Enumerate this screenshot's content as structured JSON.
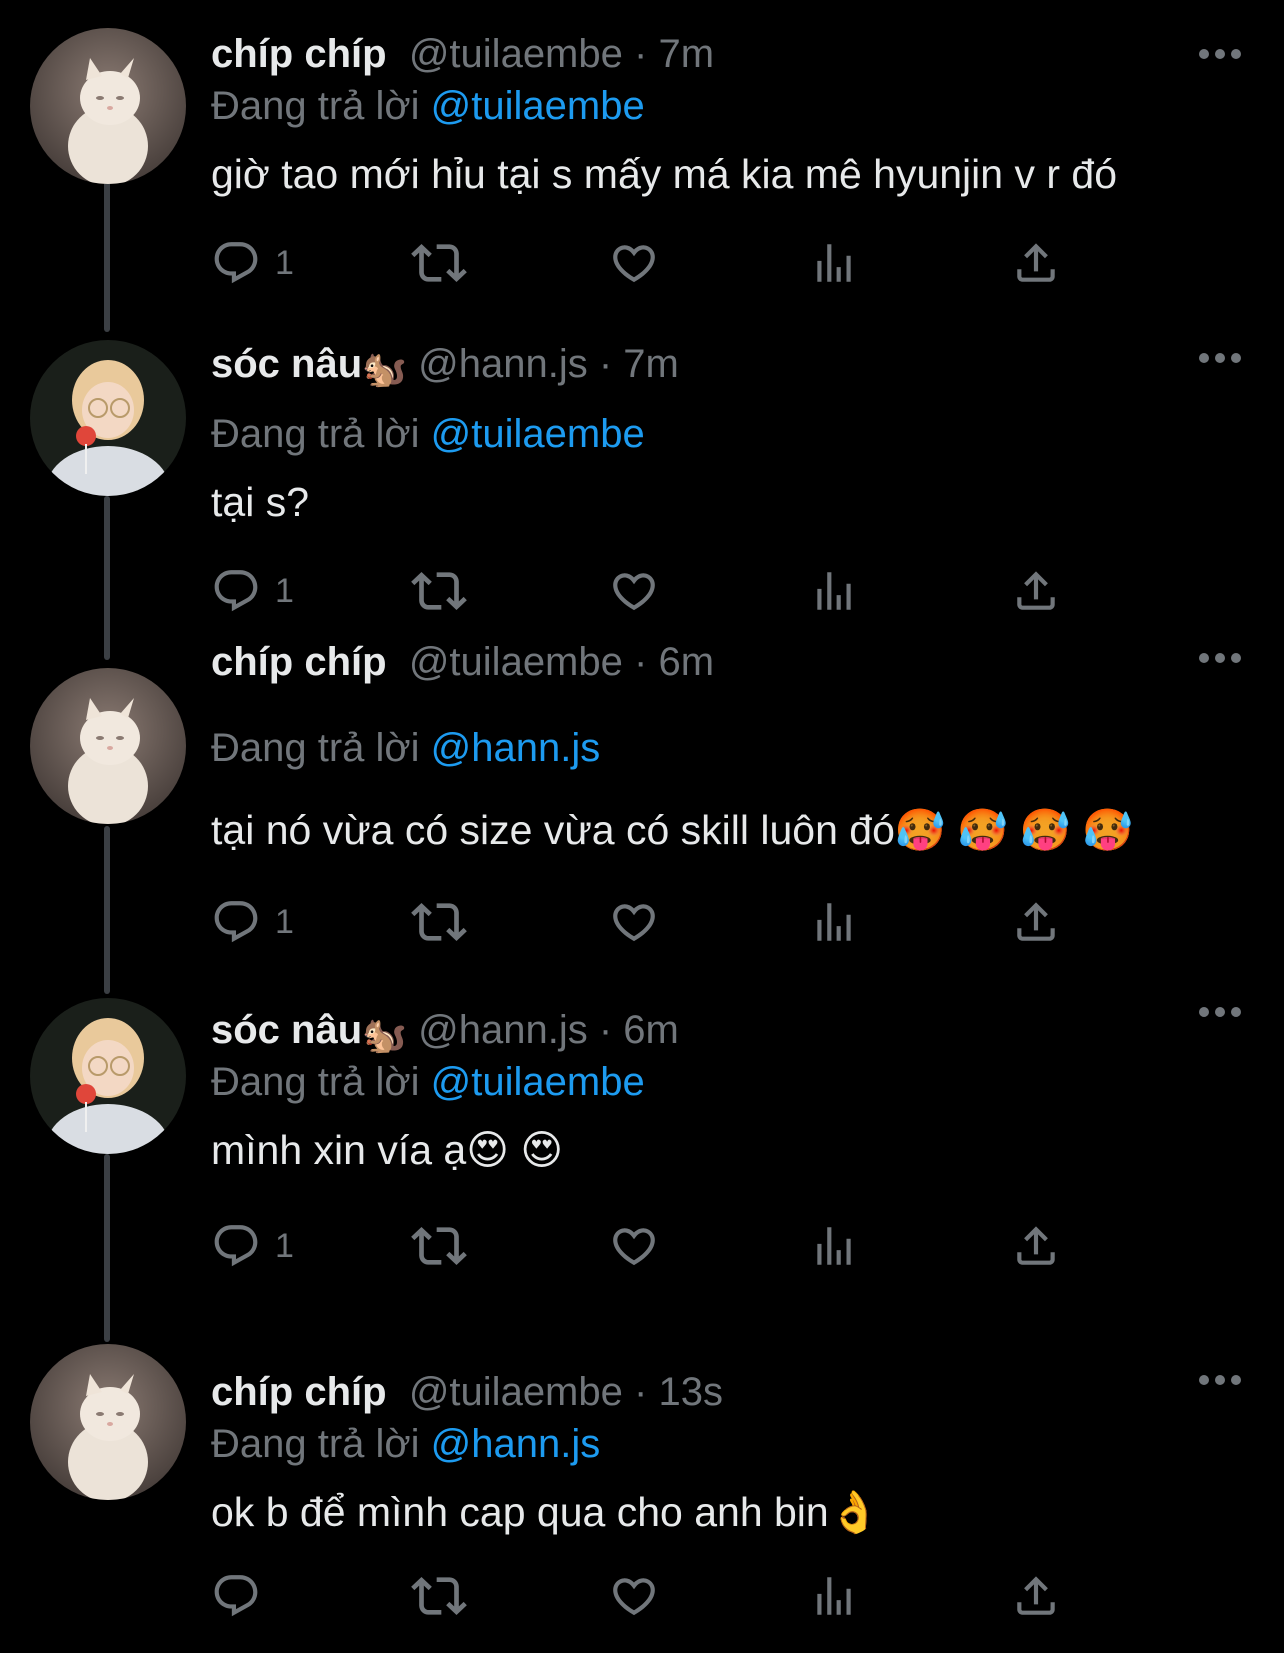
{
  "tweets": [
    {
      "display_name": "chíp chíp",
      "name_emoji": "",
      "handle": "@tuilaembe",
      "separator": "·",
      "time": "7m",
      "replying_label": "Đang trả lời",
      "replying_to": "@tuilaembe",
      "text": "giờ tao mới hỉu tại s mấy má kia mê hyunjin v r đó",
      "reply_count": "1",
      "avatar": "cat-avatar"
    },
    {
      "display_name": "sóc nâu",
      "name_emoji": "🐿️",
      "handle": "@hann.js",
      "separator": "·",
      "time": "7m",
      "replying_label": "Đang trả lời",
      "replying_to": "@tuilaembe",
      "text": "tại s?",
      "reply_count": "1",
      "avatar": "person-avatar"
    },
    {
      "display_name": "chíp chíp",
      "name_emoji": "",
      "handle": "@tuilaembe",
      "separator": "·",
      "time": "6m",
      "replying_label": "Đang trả lời",
      "replying_to": "@hann.js",
      "text": "tại nó vừa có size vừa có skill luôn đó🥵 🥵 🥵 🥵",
      "reply_count": "1",
      "avatar": "cat-avatar"
    },
    {
      "display_name": "sóc nâu",
      "name_emoji": "🐿️",
      "handle": "@hann.js",
      "separator": "·",
      "time": "6m",
      "replying_label": "Đang trả lời",
      "replying_to": "@tuilaembe",
      "text": "mình xin vía ạ😍 😍",
      "reply_count": "1",
      "avatar": "person-avatar"
    },
    {
      "display_name": "chíp chíp",
      "name_emoji": "",
      "handle": "@tuilaembe",
      "separator": "·",
      "time": "13s",
      "replying_label": "Đang trả lời",
      "replying_to": "@hann.js",
      "text": "ok b để mình cap qua cho anh bin👌",
      "reply_count": "",
      "avatar": "cat-avatar"
    }
  ],
  "icons": {
    "reply": "reply-icon",
    "retweet": "retweet-icon",
    "like": "heart-icon",
    "views": "views-icon",
    "share": "share-icon",
    "more": "more-dots-icon"
  },
  "colors": {
    "background": "#000000",
    "text": "#e7e9ea",
    "muted": "#71767b",
    "link": "#1d9bf0",
    "thread_line": "#3b3f44"
  }
}
